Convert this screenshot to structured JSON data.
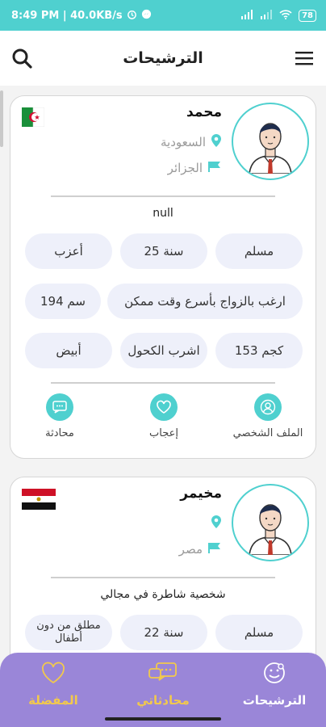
{
  "status_bar": {
    "left_text": "8:49 PM | 40.0KB/s",
    "battery": "78"
  },
  "app_bar": {
    "title": "الترشيحات",
    "menu_icon": "menu-icon",
    "search_icon": "search-icon"
  },
  "cards": [
    {
      "name": "محمد",
      "residence": "السعودية",
      "nationality": "الجزائر",
      "flag": "algeria",
      "bio": "null",
      "chips": {
        "religion": "مسلم",
        "age": "25 سنة",
        "marital": "أعزب",
        "marriage_goal": "ارغب بالزواج بأسرع وقت ممكن",
        "height": "194 سم",
        "weight": "153 كجم",
        "alcohol": "اشرب الكحول",
        "skin": "أبيض"
      },
      "actions": {
        "profile": "الملف الشخصي",
        "like": "إعجاب",
        "chat": "محادثة"
      }
    },
    {
      "name": "مخيمر",
      "residence": "",
      "nationality": "مصر",
      "flag": "egypt",
      "bio": "شخصية شاطرة في مجالي",
      "chips": {
        "religion": "مسلم",
        "age": "22 سنة",
        "marital": "مطلق من دون أطفال"
      }
    }
  ],
  "bottom_nav": {
    "recommendations": "الترشيحات",
    "chats": "محادثاتي",
    "favorites": "المفضلة"
  },
  "colors": {
    "accent": "#4fd0cf",
    "nav_bg": "#9a86d8",
    "nav_inactive": "#f2c94c",
    "chip_bg": "#eef0fa"
  }
}
